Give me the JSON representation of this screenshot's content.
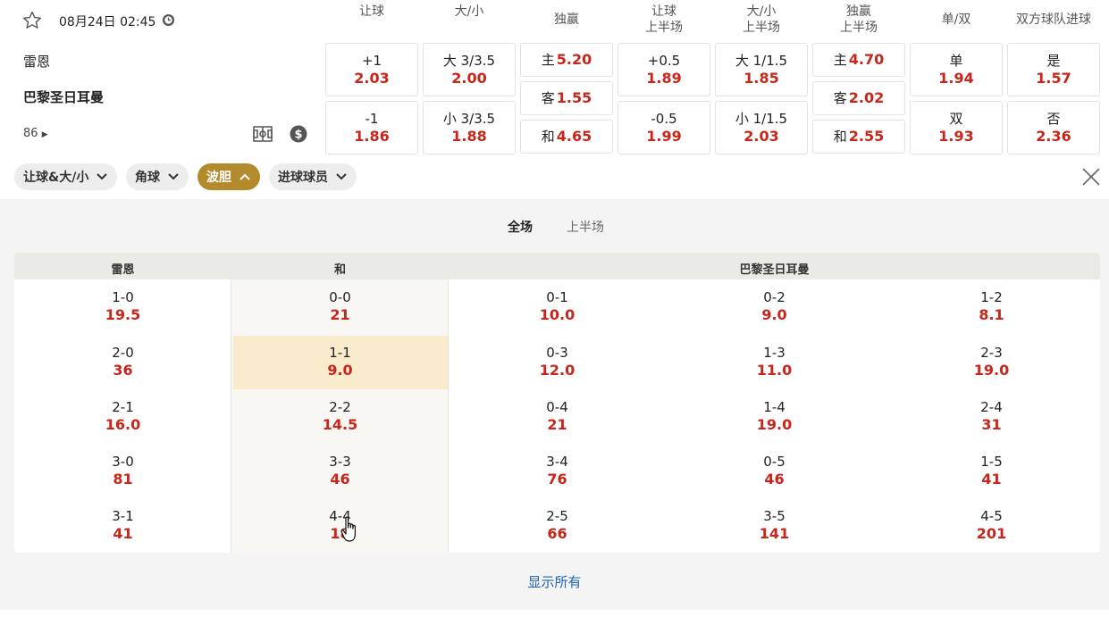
{
  "match": {
    "datetime": "08月24日 02:45",
    "home": "雷恩",
    "away": "巴黎圣日耳曼",
    "markets_count": "86"
  },
  "columns": [
    {
      "line1": "让球",
      "line2": ""
    },
    {
      "line1": "大/小",
      "line2": ""
    },
    {
      "line1": "独赢",
      "line2": ""
    },
    {
      "line1": "让球",
      "line2": "上半场"
    },
    {
      "line1": "大/小",
      "line2": "上半场"
    },
    {
      "line1": "独赢",
      "line2": "上半场"
    },
    {
      "line1": "单/双",
      "line2": ""
    },
    {
      "line1": "双方球队进球",
      "line2": ""
    }
  ],
  "odds": {
    "handicap": [
      {
        "label": "+1",
        "odds": "2.03"
      },
      {
        "label": "-1",
        "odds": "1.86"
      }
    ],
    "total": [
      {
        "label": "大 3/3.5",
        "odds": "2.00"
      },
      {
        "label": "小 3/3.5",
        "odds": "1.88"
      }
    ],
    "win": [
      {
        "label": "主",
        "odds": "5.20"
      },
      {
        "label": "客",
        "odds": "1.55"
      },
      {
        "label": "和",
        "odds": "4.65"
      }
    ],
    "handicap_1h": [
      {
        "label": "+0.5",
        "odds": "1.89"
      },
      {
        "label": "-0.5",
        "odds": "1.99"
      }
    ],
    "total_1h": [
      {
        "label": "大 1/1.5",
        "odds": "1.85"
      },
      {
        "label": "小 1/1.5",
        "odds": "2.03"
      }
    ],
    "win_1h": [
      {
        "label": "主",
        "odds": "4.70"
      },
      {
        "label": "客",
        "odds": "2.02"
      },
      {
        "label": "和",
        "odds": "2.55"
      }
    ],
    "odd_even": [
      {
        "label": "单",
        "odds": "1.94"
      },
      {
        "label": "双",
        "odds": "1.93"
      }
    ],
    "btts": [
      {
        "label": "是",
        "odds": "1.57"
      },
      {
        "label": "否",
        "odds": "2.36"
      }
    ]
  },
  "filters": [
    {
      "label": "让球&大/小",
      "active": false
    },
    {
      "label": "角球",
      "active": false
    },
    {
      "label": "波胆",
      "active": true
    },
    {
      "label": "进球球员",
      "active": false
    }
  ],
  "subtabs": {
    "full": "全场",
    "half": "上半场"
  },
  "correct_score": {
    "headers": {
      "home": "雷恩",
      "draw": "和",
      "away": "巴黎圣日耳曼"
    },
    "home": [
      {
        "score": "1-0",
        "odds": "19.5"
      },
      {
        "score": "2-0",
        "odds": "36"
      },
      {
        "score": "2-1",
        "odds": "16.0"
      },
      {
        "score": "3-0",
        "odds": "81"
      },
      {
        "score": "3-1",
        "odds": "41"
      }
    ],
    "draw": [
      {
        "score": "0-0",
        "odds": "21"
      },
      {
        "score": "1-1",
        "odds": "9.0"
      },
      {
        "score": "2-2",
        "odds": "14.5"
      },
      {
        "score": "3-3",
        "odds": "46"
      },
      {
        "score": "4-4",
        "odds": "18"
      }
    ],
    "away1": [
      {
        "score": "0-1",
        "odds": "10.0"
      },
      {
        "score": "0-3",
        "odds": "12.0"
      },
      {
        "score": "0-4",
        "odds": "21"
      },
      {
        "score": "3-4",
        "odds": "76"
      },
      {
        "score": "2-5",
        "odds": "66"
      }
    ],
    "away2": [
      {
        "score": "0-2",
        "odds": "9.0"
      },
      {
        "score": "1-3",
        "odds": "11.0"
      },
      {
        "score": "1-4",
        "odds": "19.0"
      },
      {
        "score": "0-5",
        "odds": "46"
      },
      {
        "score": "3-5",
        "odds": "141"
      }
    ],
    "away3": [
      {
        "score": "1-2",
        "odds": "8.1"
      },
      {
        "score": "2-3",
        "odds": "19.0"
      },
      {
        "score": "2-4",
        "odds": "31"
      },
      {
        "score": "1-5",
        "odds": "41"
      },
      {
        "score": "4-5",
        "odds": "201"
      }
    ]
  },
  "show_all": "显示所有",
  "colors": {
    "odds": "#c8251b",
    "active_pill": "#b38b2d",
    "highlight": "#faebcc",
    "link": "#1d63b8"
  }
}
